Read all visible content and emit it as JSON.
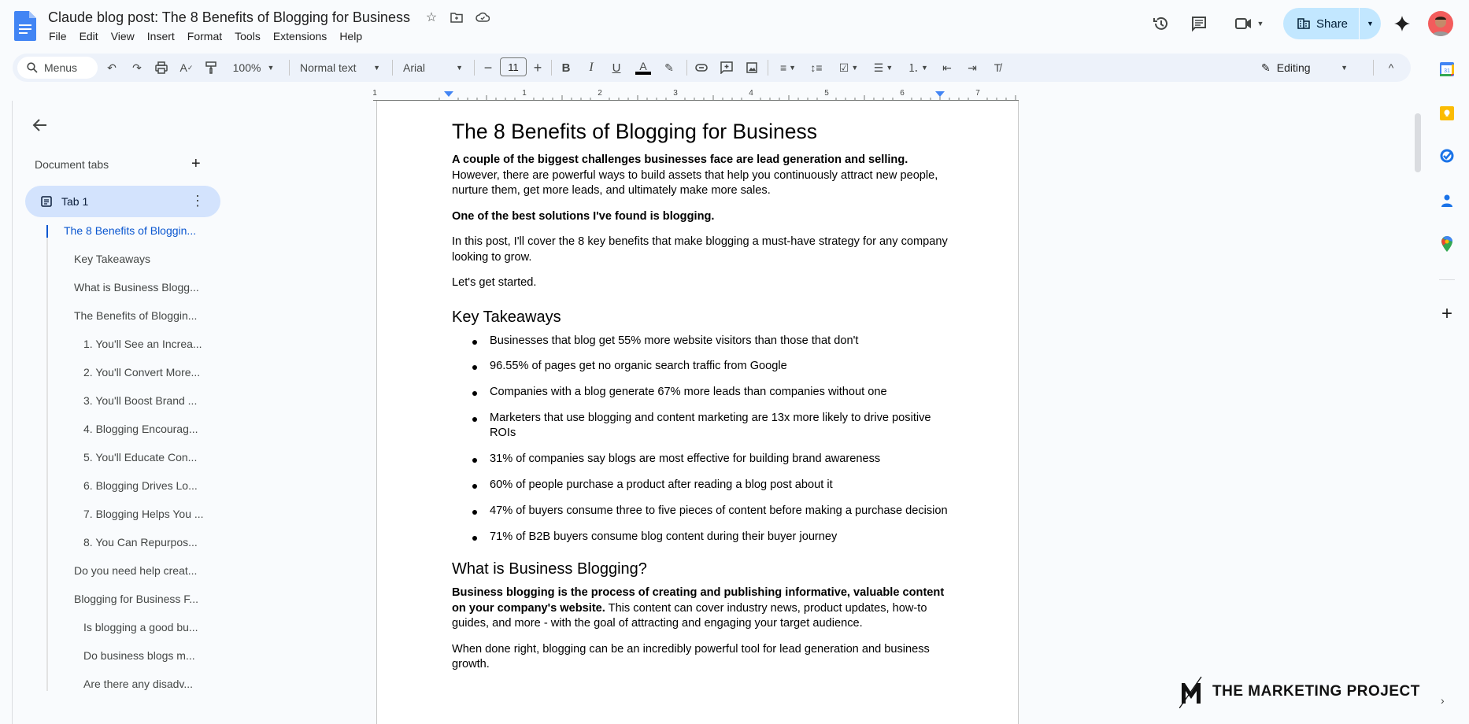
{
  "header": {
    "doc_title": "Claude blog post: The 8 Benefits of Blogging for Business",
    "menu": [
      "File",
      "Edit",
      "View",
      "Insert",
      "Format",
      "Tools",
      "Extensions",
      "Help"
    ],
    "share_label": "Share"
  },
  "toolbar": {
    "search_label": "Menus",
    "zoom": "100%",
    "style": "Normal text",
    "font": "Arial",
    "font_size": "11",
    "mode": "Editing"
  },
  "ruler": {
    "ticks": [
      "1",
      "1",
      "2",
      "3",
      "4",
      "5",
      "6",
      "7"
    ]
  },
  "sidebar": {
    "title": "Document tabs",
    "tab_name": "Tab 1",
    "outline": [
      {
        "label": "The 8 Benefits of Bloggin...",
        "level": 0,
        "active": true
      },
      {
        "label": "Key Takeaways",
        "level": 1
      },
      {
        "label": "What is Business Blogg...",
        "level": 1
      },
      {
        "label": "The Benefits of Bloggin...",
        "level": 1
      },
      {
        "label": "1. You'll See an Increa...",
        "level": 2
      },
      {
        "label": "2. You'll Convert More...",
        "level": 2
      },
      {
        "label": "3. You'll Boost Brand ...",
        "level": 2
      },
      {
        "label": "4. Blogging Encourag...",
        "level": 2
      },
      {
        "label": "5. You'll Educate Con...",
        "level": 2
      },
      {
        "label": "6. Blogging Drives Lo...",
        "level": 2
      },
      {
        "label": "7. Blogging Helps You ...",
        "level": 2
      },
      {
        "label": "8. You Can Repurpos...",
        "level": 2
      },
      {
        "label": "Do you need help creat...",
        "level": 1
      },
      {
        "label": "Blogging for Business F...",
        "level": 1
      },
      {
        "label": "Is blogging a good bu...",
        "level": 2
      },
      {
        "label": "Do business blogs m...",
        "level": 2
      },
      {
        "label": "Are there any disadv...",
        "level": 2
      }
    ]
  },
  "document": {
    "title": "The 8 Benefits of Blogging for Business",
    "intro_bold": "A couple of the biggest challenges businesses face are lead generation and selling.",
    "intro_rest": " However, there are powerful ways to build assets that help you continuously attract new people, nurture them, get more leads, and ultimately make more sales.",
    "p2": "One of the best solutions I've found is blogging.",
    "p3": "In this post, I'll cover the 8 key benefits that make blogging a must-have strategy for any company looking to grow.",
    "p4": "Let's get started.",
    "h_takeaways": "Key Takeaways",
    "takeaways": [
      "Businesses that blog get 55% more website visitors than those that don't",
      "96.55% of pages get no organic search traffic from Google",
      "Companies with a blog generate 67% more leads than companies without one",
      "Marketers that use blogging and content marketing are 13x more likely to drive positive ROIs",
      "31% of companies say blogs are most effective for building brand awareness",
      "60% of people purchase a product after reading a blog post about it",
      "47% of buyers consume three to five pieces of content before making a purchase decision",
      "71% of B2B buyers consume blog content during their buyer journey"
    ],
    "h_what": "What is Business Blogging?",
    "what_bold": "Business blogging is the process of creating and publishing informative, valuable content on your company's website.",
    "what_rest": " This content can cover industry news, product updates, how-to guides, and more - with the goal of attracting and engaging your target audience.",
    "p_done": "When done right, blogging can be an incredibly powerful tool for lead generation and business growth."
  },
  "watermark": {
    "text": "THE MARKETING PROJECT"
  }
}
